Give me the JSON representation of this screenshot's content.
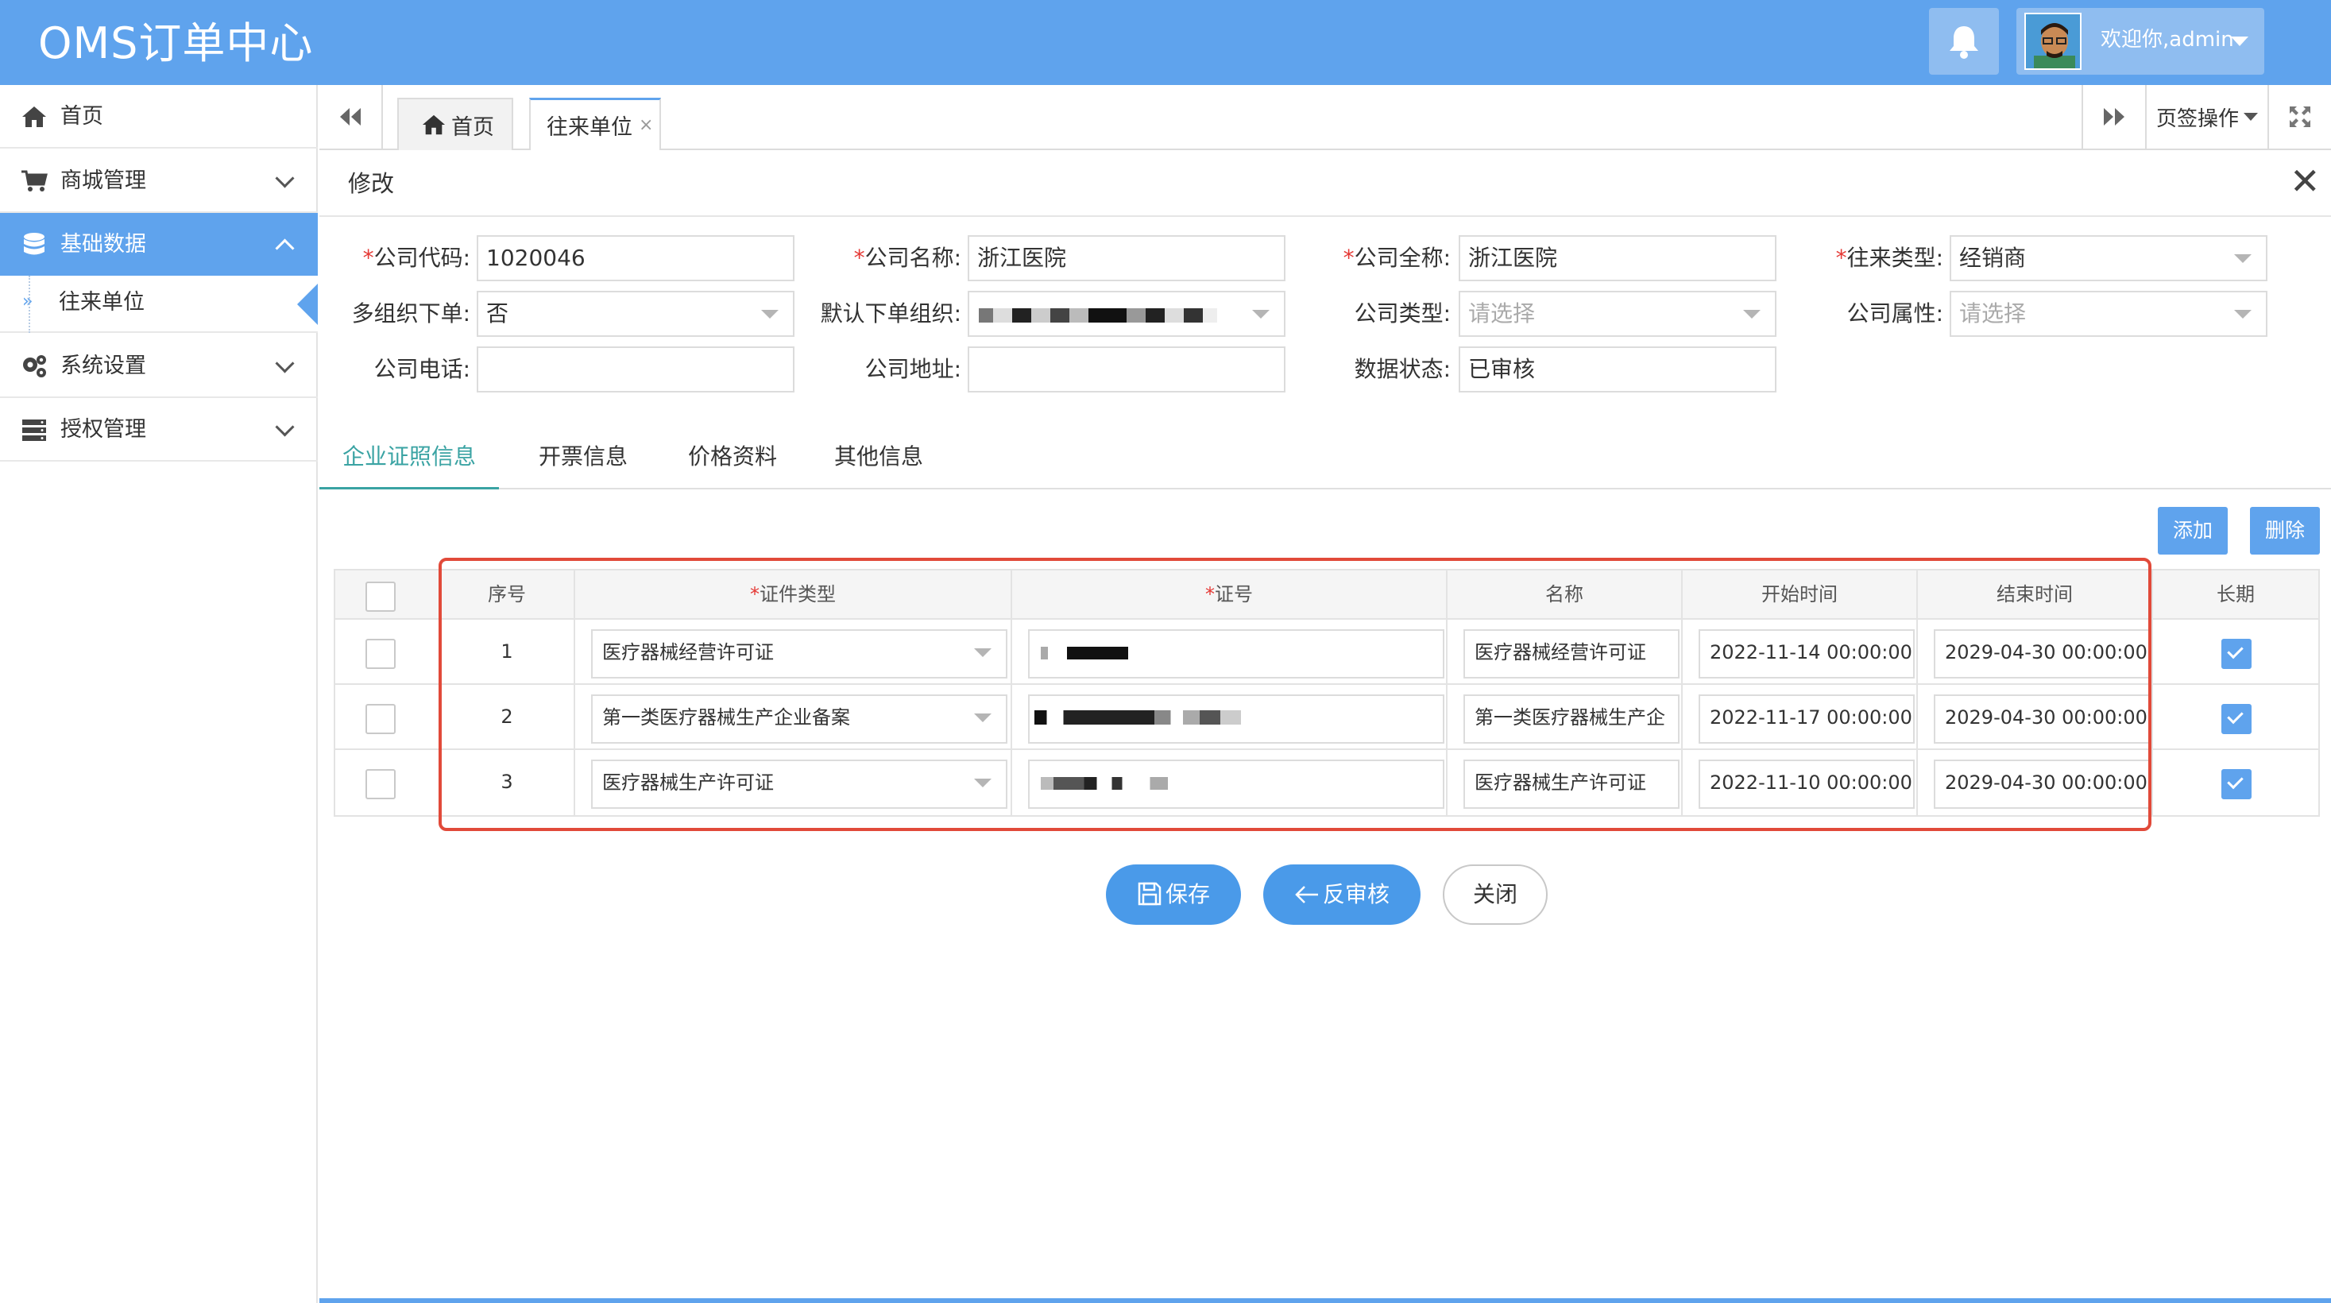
{
  "header": {
    "app_title": "OMS订单中心",
    "welcome": "欢迎你,admin"
  },
  "sidebar": {
    "items": [
      {
        "label": "首页",
        "icon": "home-icon"
      },
      {
        "label": "商城管理",
        "icon": "cart-icon"
      },
      {
        "label": "基础数据",
        "icon": "database-icon",
        "active": true
      },
      {
        "label": "系统设置",
        "icon": "gears-icon"
      },
      {
        "label": "授权管理",
        "icon": "server-icon"
      }
    ],
    "sub_item": "往来单位"
  },
  "tabs": {
    "home_label": "首页",
    "active_label": "往来单位",
    "close_symbol": "×",
    "page_ops": "页签操作"
  },
  "page": {
    "title": "修改",
    "close_symbol": "✕"
  },
  "form": {
    "company_code": {
      "label": "公司代码:",
      "value": "1020046"
    },
    "company_name": {
      "label": "公司名称:",
      "value": "浙江医院"
    },
    "company_full_name": {
      "label": "公司全称:",
      "value": "浙江医院"
    },
    "partner_type": {
      "label": "往来类型:",
      "value": "经销商"
    },
    "multi_org": {
      "label": "多组织下单:",
      "value": "否"
    },
    "default_org": {
      "label": "默认下单组织:",
      "value": ""
    },
    "company_type": {
      "label": "公司类型:",
      "placeholder": "请选择"
    },
    "company_attr": {
      "label": "公司属性:",
      "placeholder": "请选择"
    },
    "company_phone": {
      "label": "公司电话:",
      "value": ""
    },
    "company_address": {
      "label": "公司地址:",
      "value": ""
    },
    "data_status": {
      "label": "数据状态:",
      "value": "已审核"
    }
  },
  "inner_tabs": [
    "企业证照信息",
    "开票信息",
    "价格资料",
    "其他信息"
  ],
  "table_actions": {
    "add": "添加",
    "delete": "删除"
  },
  "table": {
    "headers": {
      "index": "序号",
      "cert_type": "证件类型",
      "cert_no": "证号",
      "name": "名称",
      "start": "开始时间",
      "end": "结束时间",
      "long_term": "长期"
    },
    "rows": [
      {
        "index": "1",
        "cert_type": "医疗器械经营许可证",
        "cert_no": "",
        "name": "医疗器械经营许可证",
        "start": "2022-11-14 00:00:00",
        "end": "2029-04-30 00:00:00",
        "long_term": true
      },
      {
        "index": "2",
        "cert_type": "第一类医疗器械生产企业备案",
        "cert_no": "",
        "name": "第一类医疗器械生产企",
        "start": "2022-11-17 00:00:00",
        "end": "2029-04-30 00:00:00",
        "long_term": true
      },
      {
        "index": "3",
        "cert_type": "医疗器械生产许可证",
        "cert_no": "",
        "name": "医疗器械生产许可证",
        "start": "2022-11-10 00:00:00",
        "end": "2029-04-30 00:00:00",
        "long_term": true
      }
    ]
  },
  "footer_buttons": {
    "save": "保存",
    "unaudit": "反审核",
    "close": "关闭"
  },
  "colors": {
    "primary": "#5fa3ed",
    "highlight_border": "#e14a3a",
    "required": "#e53935",
    "tab_active": "#3aa3a3"
  }
}
